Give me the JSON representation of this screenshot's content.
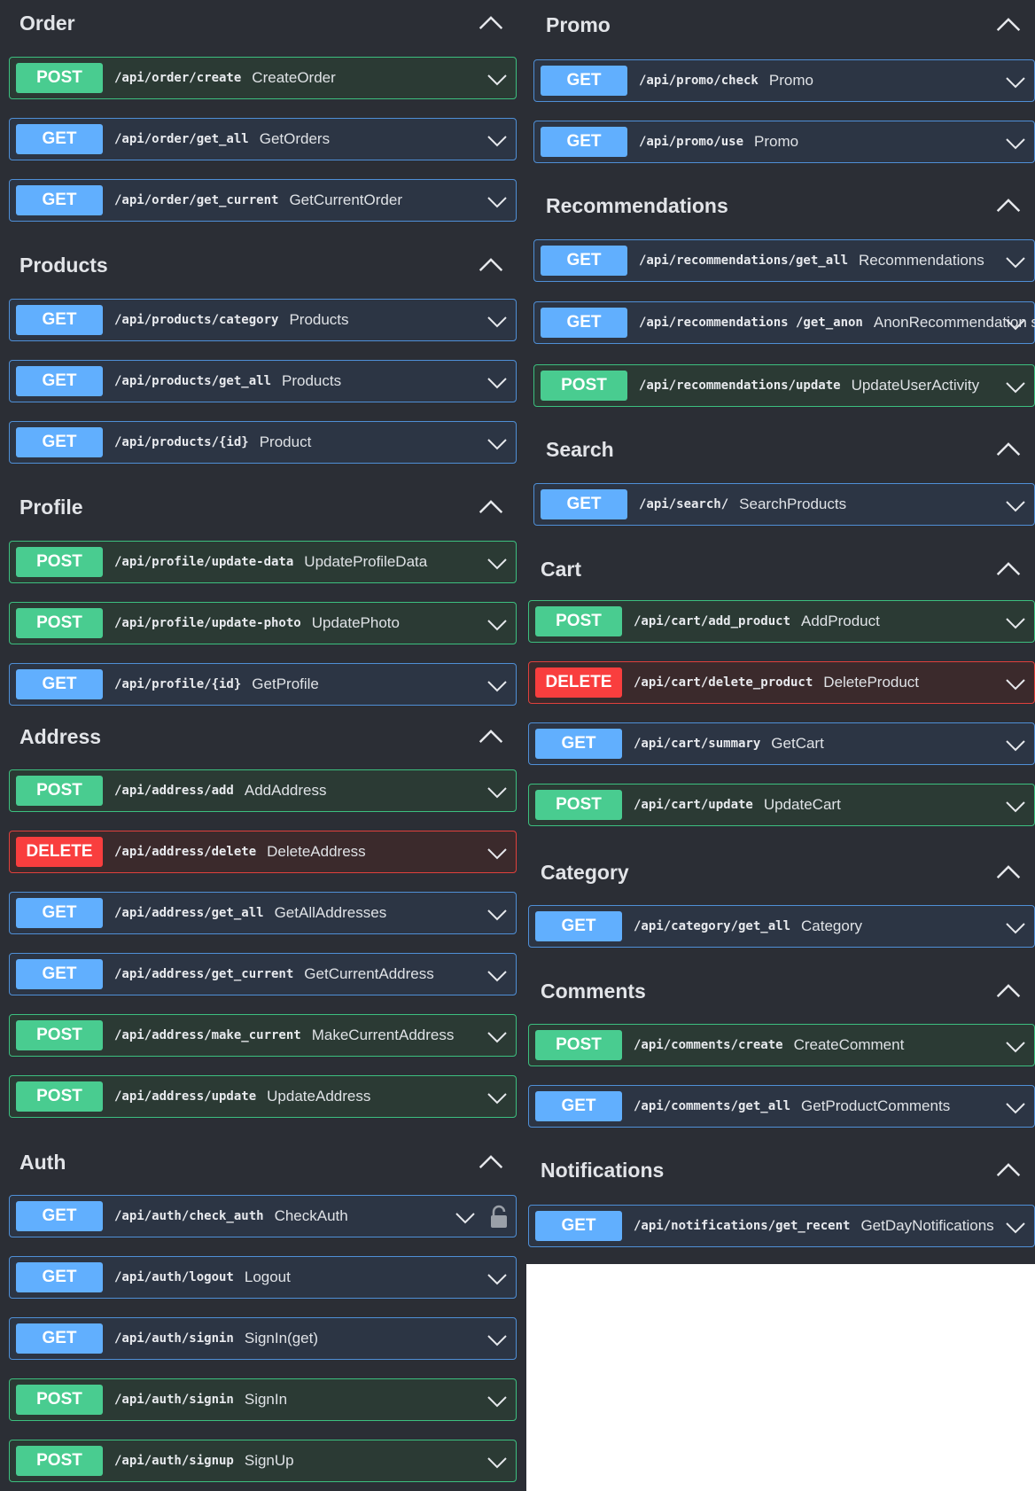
{
  "left": [
    {
      "title": "Order",
      "ops": [
        {
          "method": "POST",
          "path": "/api/order/create",
          "summary": "CreateOrder"
        },
        {
          "method": "GET",
          "path": "/api/order/get_all",
          "summary": "GetOrders"
        },
        {
          "method": "GET",
          "path": "/api/order/get_current",
          "summary": "GetCurrentOrder"
        }
      ]
    },
    {
      "title": "Products",
      "ops": [
        {
          "method": "GET",
          "path": "/api/products/category",
          "summary": "Products"
        },
        {
          "method": "GET",
          "path": "/api/products/get_all",
          "summary": "Products"
        },
        {
          "method": "GET",
          "path": "/api/products/{id}",
          "summary": "Product"
        }
      ]
    },
    {
      "title": "Profile",
      "ops": [
        {
          "method": "POST",
          "path": "/api/profile/update-data",
          "summary": "UpdateProfileData"
        },
        {
          "method": "POST",
          "path": "/api/profile/update-photo",
          "summary": "UpdatePhoto"
        },
        {
          "method": "GET",
          "path": "/api/profile/{id}",
          "summary": "GetProfile"
        }
      ]
    },
    {
      "title": "Address",
      "ops": [
        {
          "method": "POST",
          "path": "/api/address/add",
          "summary": "AddAddress"
        },
        {
          "method": "DELETE",
          "path": "/api/address/delete",
          "summary": "DeleteAddress"
        },
        {
          "method": "GET",
          "path": "/api/address/get_all",
          "summary": "GetAllAddresses"
        },
        {
          "method": "GET",
          "path": "/api/address/get_current",
          "summary": "GetCurrentAddress"
        },
        {
          "method": "POST",
          "path": "/api/address/make_current",
          "summary": "MakeCurrentAddress"
        },
        {
          "method": "POST",
          "path": "/api/address/update",
          "summary": "UpdateAddress"
        }
      ]
    },
    {
      "title": "Auth",
      "ops": [
        {
          "method": "GET",
          "path": "/api/auth/check_auth",
          "summary": "CheckAuth",
          "locked": true
        },
        {
          "method": "GET",
          "path": "/api/auth/logout",
          "summary": "Logout"
        },
        {
          "method": "GET",
          "path": "/api/auth/signin",
          "summary": "SignIn(get)"
        },
        {
          "method": "POST",
          "path": "/api/auth/signin",
          "summary": "SignIn"
        },
        {
          "method": "POST",
          "path": "/api/auth/signup",
          "summary": "SignUp"
        }
      ]
    }
  ],
  "right": [
    {
      "title": "Promo",
      "ops": [
        {
          "method": "GET",
          "path": "/api/promo/check",
          "summary": "Promo"
        },
        {
          "method": "GET",
          "path": "/api/promo/use",
          "summary": "Promo"
        }
      ]
    },
    {
      "title": "Recommendations",
      "ops": [
        {
          "method": "GET",
          "path": "/api/recommendations/get_all",
          "summary": "Recommendations"
        },
        {
          "method": "GET",
          "path": "/api/recommendations /get_anon",
          "summary": "AnonRecommendation s"
        },
        {
          "method": "POST",
          "path": "/api/recommendations/update",
          "summary": "UpdateUserActivity"
        }
      ]
    },
    {
      "title": "Search",
      "ops": [
        {
          "method": "GET",
          "path": "/api/search/",
          "summary": "SearchProducts"
        }
      ]
    },
    {
      "title": "Cart",
      "ops": [
        {
          "method": "POST",
          "path": "/api/cart/add_product",
          "summary": "AddProduct"
        },
        {
          "method": "DELETE",
          "path": "/api/cart/delete_product",
          "summary": "DeleteProduct"
        },
        {
          "method": "GET",
          "path": "/api/cart/summary",
          "summary": "GetCart"
        },
        {
          "method": "POST",
          "path": "/api/cart/update",
          "summary": "UpdateCart"
        }
      ]
    },
    {
      "title": "Category",
      "ops": [
        {
          "method": "GET",
          "path": "/api/category/get_all",
          "summary": "Category"
        }
      ]
    },
    {
      "title": "Comments",
      "ops": [
        {
          "method": "POST",
          "path": "/api/comments/create",
          "summary": "CreateComment"
        },
        {
          "method": "GET",
          "path": "/api/comments/get_all",
          "summary": "GetProductComments"
        }
      ]
    },
    {
      "title": "Notifications",
      "ops": [
        {
          "method": "GET",
          "path": "/api/notifications/get_recent",
          "summary": "GetDayNotifications"
        }
      ]
    }
  ],
  "colors": {
    "get": "#61affe",
    "post": "#49cc90",
    "delete": "#f93e3e",
    "panel": "#2b2e35"
  },
  "icons": {
    "collapse": "chevron-up-icon",
    "expand": "chevron-down-icon",
    "lock": "lock-icon"
  }
}
